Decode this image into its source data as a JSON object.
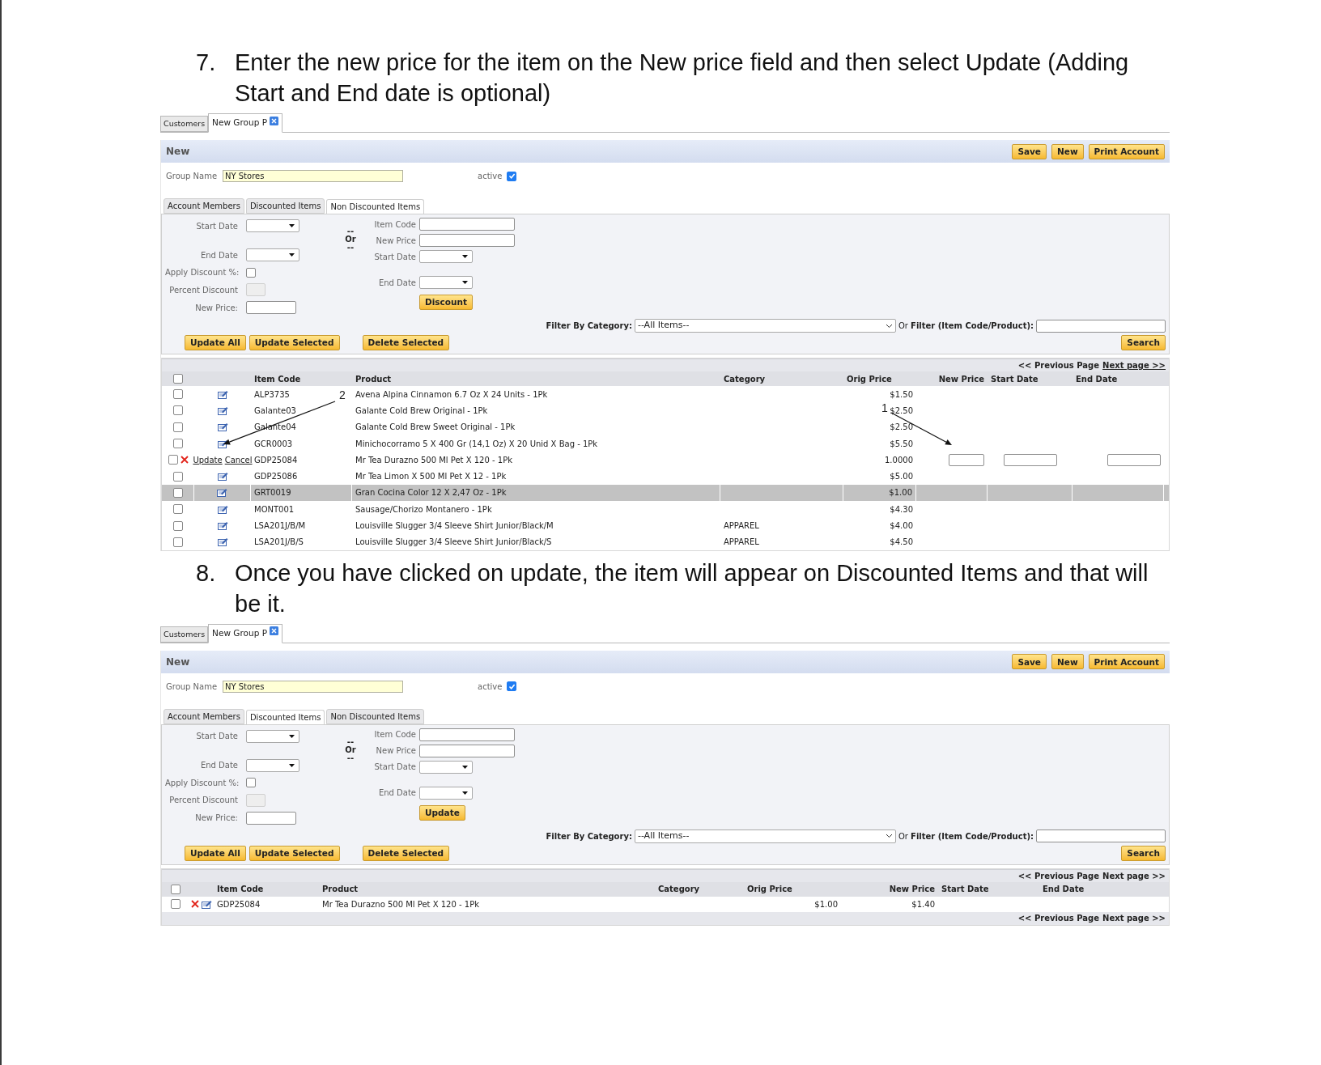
{
  "steps": [
    {
      "number": "7.",
      "text": "Enter the new price for the item on the New price field and then select Update (Adding Start and End date is optional)",
      "screenshot": {
        "top_tabs": [
          {
            "label": "Customers",
            "closable": false,
            "selected": false
          },
          {
            "label": "New Group P",
            "closable": true,
            "selected": true
          }
        ],
        "title": "New",
        "header_buttons": [
          "Save",
          "New",
          "Print Account"
        ],
        "group_name": {
          "label": "Group Name",
          "value": "NY Stores"
        },
        "active": {
          "label": "active",
          "checked": true
        },
        "tabs": [
          {
            "label": "Account Members",
            "selected": false
          },
          {
            "label": "Discounted Items",
            "selected": false
          },
          {
            "label": "Non Discounted Items",
            "selected": true
          }
        ],
        "left_fields": [
          {
            "label": "Start Date",
            "kind": "select"
          },
          {
            "label": "End Date",
            "kind": "select"
          },
          {
            "label": "Apply Discount %:",
            "kind": "checkbox",
            "checked": false
          },
          {
            "label": "Percent Discount",
            "kind": "disabled"
          },
          {
            "label": "New Price:",
            "kind": "text"
          }
        ],
        "or_label": [
          "--",
          "Or",
          "--"
        ],
        "right_fields": [
          {
            "label": "Item Code",
            "kind": "text"
          },
          {
            "label": "New Price",
            "kind": "text"
          },
          {
            "label": "Start Date",
            "kind": "select"
          },
          {
            "label": "End Date",
            "kind": "select"
          }
        ],
        "apply_button": "Discount",
        "action_buttons": [
          "Update All",
          "Update Selected",
          "Delete Selected"
        ],
        "filter_category": {
          "label": "Filter By Category:",
          "value": "--All Items--"
        },
        "filter_text": {
          "label": "Or **Filter (Item Code/Product):**"
        },
        "search_button": "Search",
        "pager": [
          {
            "label": "<< Previous Page",
            "link": false
          },
          {
            "label": "Next page >>",
            "link": true
          }
        ],
        "all_checked": false,
        "columns": [
          "Item Code",
          "Product",
          "Category",
          "Orig Price",
          "New Price",
          "Start Date",
          "End Date"
        ],
        "rows": [
          {
            "kind": "item",
            "checked": false,
            "selected": false,
            "item_code": "ALP3735",
            "product": "Avena Alpina Cinnamon 6.7 Oz X 24 Units - 1Pk",
            "orig_price": "$1.50"
          },
          {
            "kind": "item",
            "checked": false,
            "selected": false,
            "item_code": "Galante03",
            "product": "Galante Cold Brew Original - 1Pk",
            "orig_price": "$2.50"
          },
          {
            "kind": "item",
            "checked": false,
            "selected": false,
            "item_code": "Galante04",
            "product": "Galante Cold Brew Sweet Original - 1Pk",
            "orig_price": "$2.50"
          },
          {
            "kind": "item",
            "checked": false,
            "selected": false,
            "item_code": "GCR0003",
            "product": "Minichocorramo 5 X 400 Gr (14,1 Oz) X 20 Unid X Bag - 1Pk",
            "orig_price": "$5.50"
          },
          {
            "kind": "editing",
            "checked": false,
            "selected": false,
            "links": [
              "Update",
              "Cancel"
            ],
            "item_code": "GDP25084",
            "product": "Mr Tea Durazno 500 Ml Pet X 120 - 1Pk",
            "orig_price": "1.0000"
          },
          {
            "kind": "item",
            "checked": false,
            "selected": false,
            "item_code": "GDP25086",
            "product": "Mr Tea Limon X 500 Ml Pet X 12 - 1Pk",
            "orig_price": "$5.00"
          },
          {
            "kind": "item",
            "checked": false,
            "selected": true,
            "item_code": "GRT0019",
            "product": "Gran Cocina Color 12 X 2,47 Oz - 1Pk",
            "orig_price": "$1.00"
          },
          {
            "kind": "item",
            "checked": false,
            "selected": false,
            "item_code": "MONT001",
            "product": "Sausage/Chorizo Montanero - 1Pk",
            "orig_price": "$4.30"
          },
          {
            "kind": "item",
            "checked": false,
            "selected": false,
            "item_code": "LSA201J/B/M",
            "product": "Louisville Slugger 3/4 Sleeve Shirt Junior/Black/M",
            "category": "APPAREL",
            "orig_price": "$4.00"
          },
          {
            "kind": "item",
            "checked": false,
            "selected": false,
            "item_code": "LSA201J/B/S",
            "product": "Louisville Slugger 3/4 Sleeve Shirt Junior/Black/S",
            "category": "APPAREL",
            "orig_price": "$4.50"
          }
        ],
        "annotations": [
          {
            "label": "2"
          },
          {
            "label": "1"
          }
        ]
      }
    },
    {
      "number": "8.",
      "text": "Once you have clicked on update, the item will appear on Discounted Items and that will be it.",
      "screenshot": {
        "top_tabs": [
          {
            "label": "Customers",
            "closable": false,
            "selected": false
          },
          {
            "label": "New Group P",
            "closable": true,
            "selected": true
          }
        ],
        "title": "New",
        "header_buttons": [
          "Save",
          "New",
          "Print Account"
        ],
        "group_name": {
          "label": "Group Name",
          "value": "NY Stores"
        },
        "active": {
          "label": "active",
          "checked": true
        },
        "tabs": [
          {
            "label": "Account Members",
            "selected": false
          },
          {
            "label": "Discounted Items",
            "selected": true
          },
          {
            "label": "Non Discounted Items",
            "selected": false
          }
        ],
        "left_fields": [
          {
            "label": "Start Date",
            "kind": "select"
          },
          {
            "label": "End Date",
            "kind": "select"
          },
          {
            "label": "Apply Discount %:",
            "kind": "checkbox",
            "checked": false
          },
          {
            "label": "Percent Discount",
            "kind": "disabled"
          },
          {
            "label": "New Price:",
            "kind": "text"
          }
        ],
        "or_label": [
          "--",
          "Or",
          "--"
        ],
        "right_fields": [
          {
            "label": "Item Code",
            "kind": "text"
          },
          {
            "label": "New Price",
            "kind": "text"
          },
          {
            "label": "Start Date",
            "kind": "select"
          },
          {
            "label": "End Date",
            "kind": "select"
          }
        ],
        "apply_button": "Update",
        "action_buttons": [
          "Update All",
          "Update Selected",
          "Delete Selected"
        ],
        "filter_category": {
          "label": "Filter By Category:",
          "value": "--All Items--"
        },
        "filter_text": {
          "label": "Or **Filter (Item Code/Product):**"
        },
        "search_button": "Search",
        "pager": [
          {
            "label": "<< Previous Page",
            "link": false
          },
          {
            "label": "Next page >>",
            "link": false
          }
        ],
        "all_checked": false,
        "columns": [
          "Item Code",
          "Product",
          "Category",
          "Orig Price",
          "New Price",
          "Start Date",
          "End Date"
        ],
        "rows": [
          {
            "kind": "discounted",
            "checked": false,
            "selected": false,
            "item_code": "GDP25084",
            "product": "Mr Tea Durazno 500 Ml Pet X 120 - 1Pk",
            "orig_price": "$1.00",
            "new_price": "$1.40"
          }
        ],
        "bottom_pager": [
          {
            "label": "<< Previous Page",
            "link": false
          },
          {
            "label": "Next page >>",
            "link": false
          }
        ]
      }
    }
  ]
}
